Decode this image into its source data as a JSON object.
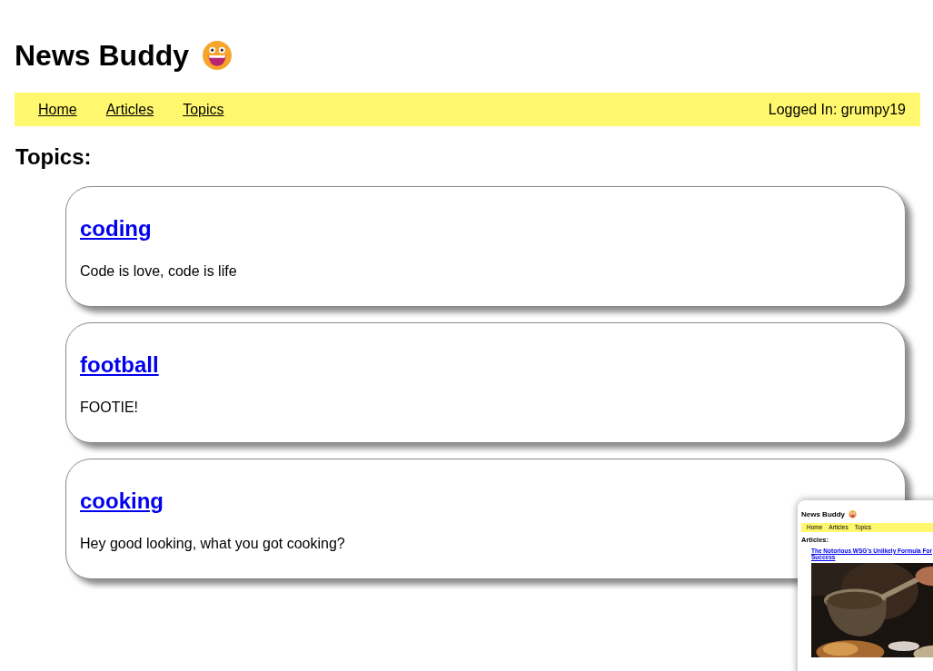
{
  "header": {
    "title": "News Buddy"
  },
  "nav": {
    "links": [
      {
        "label": "Home"
      },
      {
        "label": "Articles"
      },
      {
        "label": "Topics"
      }
    ],
    "user": "Logged In: grumpy19"
  },
  "heading": "Topics:",
  "topics": [
    {
      "slug": "coding",
      "description": "Code is love, code is life"
    },
    {
      "slug": "football",
      "description": "FOOTIE!"
    },
    {
      "slug": "cooking",
      "description": "Hey good looking, what you got cooking?"
    }
  ],
  "preview": {
    "title": "News Buddy",
    "links": [
      {
        "label": "Home"
      },
      {
        "label": "Articles"
      },
      {
        "label": "Topics"
      }
    ],
    "heading": "Articles:",
    "article_link": "The Notorious WSG's Unlikely Formula For Success"
  }
}
